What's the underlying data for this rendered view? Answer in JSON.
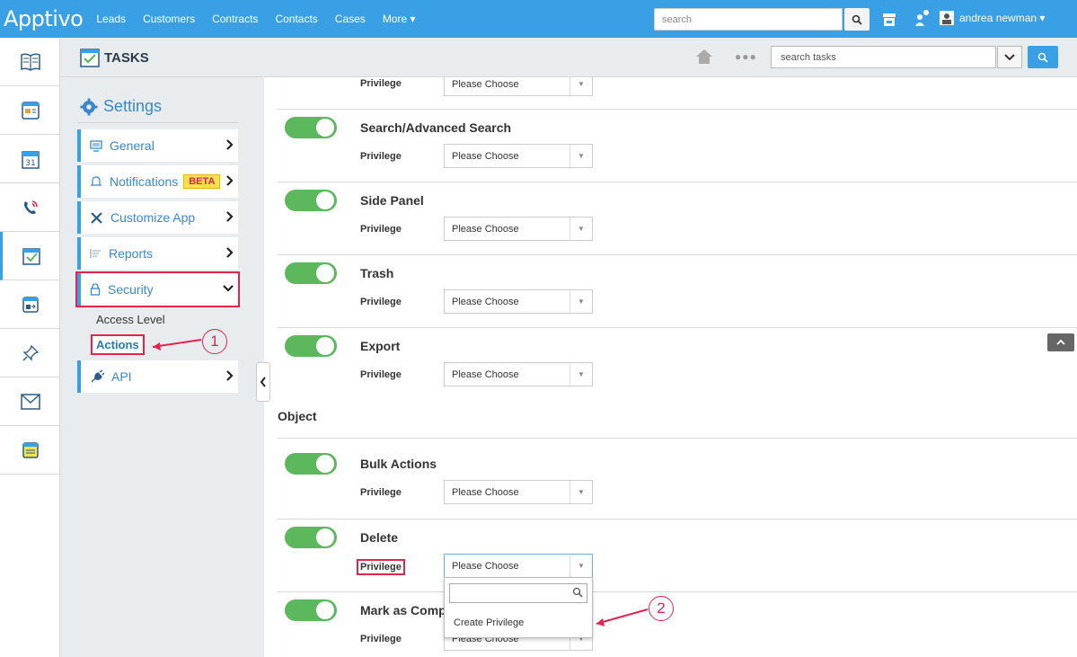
{
  "topbar": {
    "logo": "Apptivo",
    "nav": [
      "Leads",
      "Customers",
      "Contracts",
      "Contacts",
      "Cases",
      "More ▾"
    ],
    "search_placeholder": "search",
    "user_name": "andrea newman ▾"
  },
  "subheader": {
    "app_title": "TASKS",
    "more": "●●●",
    "search_value": "search tasks"
  },
  "settings": {
    "title": "Settings",
    "items": [
      {
        "label": "General"
      },
      {
        "label": "Notifications",
        "badge": "BETA"
      },
      {
        "label": "Customize App"
      },
      {
        "label": "Reports"
      },
      {
        "label": "Security"
      },
      {
        "label": "API"
      }
    ],
    "security_sub": [
      "Access Level",
      "Actions"
    ]
  },
  "annotations": {
    "callout_1": "1",
    "callout_2": "2"
  },
  "content": {
    "top_privilege_label": "Privilege",
    "top_privilege_value": "Please Choose",
    "actions": [
      {
        "title": "Search/Advanced Search",
        "privilege_label": "Privilege",
        "privilege_value": "Please Choose"
      },
      {
        "title": "Side Panel",
        "privilege_label": "Privilege",
        "privilege_value": "Please Choose"
      },
      {
        "title": "Trash",
        "privilege_label": "Privilege",
        "privilege_value": "Please Choose"
      },
      {
        "title": "Export",
        "privilege_label": "Privilege",
        "privilege_value": "Please Choose"
      }
    ],
    "object_heading": "Object",
    "object_actions": [
      {
        "title": "Bulk Actions",
        "privilege_label": "Privilege",
        "privilege_value": "Please Choose"
      },
      {
        "title": "Delete",
        "privilege_label": "Privilege",
        "privilege_value": "Please Choose"
      },
      {
        "title": "Mark as Comp",
        "privilege_label": "Privilege",
        "privilege_value": "Please Choose"
      }
    ],
    "dropdown_option": "Create Privilege"
  },
  "colors": {
    "accent": "#3aa0e6",
    "toggle_on": "#5cb85c",
    "annotation": "#e2244e"
  }
}
